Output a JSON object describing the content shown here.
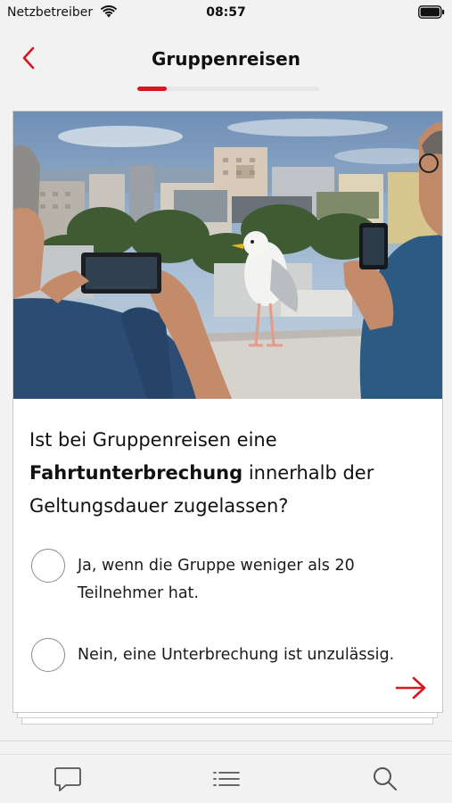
{
  "status_bar": {
    "carrier": "Netzbetreiber",
    "time": "08:57"
  },
  "nav": {
    "title": "Gruppenreisen",
    "back_icon": "chevron-left-icon",
    "accent_color": "#d8161f"
  },
  "progress": {
    "value": 0.16
  },
  "card": {
    "image_description_icon": "photo",
    "question": {
      "part1": "Ist bei Gruppenreisen eine ",
      "bold": "Fahrtunterbrechung",
      "part2": " innerhalb der Geltungsdauer zugelassen?"
    },
    "answers": [
      {
        "text": "Ja, wenn die Gruppe weniger als 20 Teilnehmer hat."
      },
      {
        "text": "Nein, eine Unterbrechung ist unzulässig."
      }
    ],
    "next_icon": "arrow-right-icon"
  },
  "tab_bar": {
    "items": [
      {
        "icon": "chat-bubble-icon"
      },
      {
        "icon": "list-icon"
      },
      {
        "icon": "search-icon"
      }
    ]
  }
}
